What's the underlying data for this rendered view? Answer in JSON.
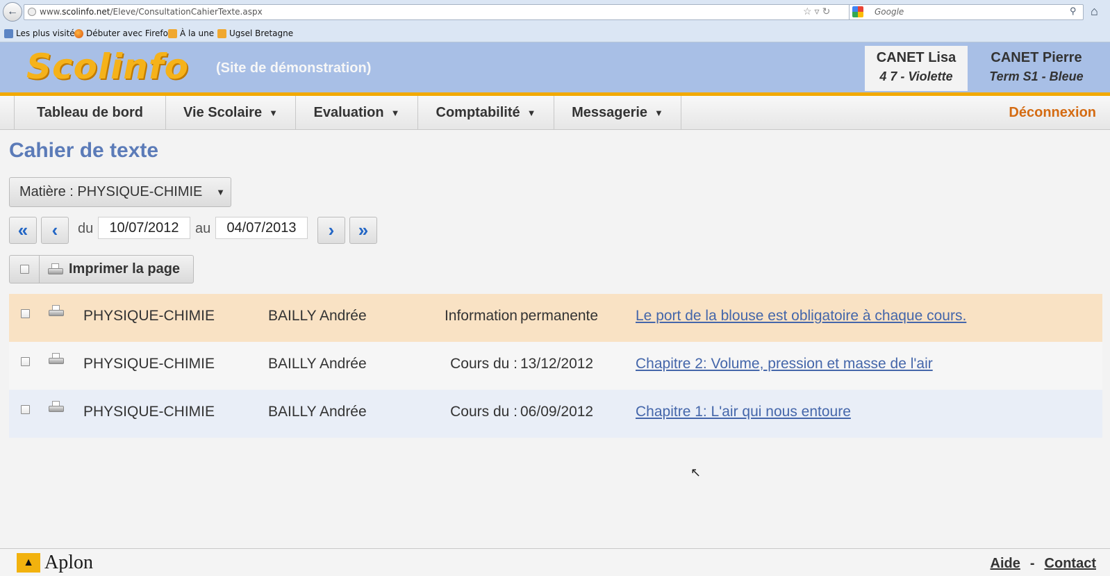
{
  "browser": {
    "url_prefix": "www.",
    "url_domain": "scolinfo.net",
    "url_path": "/Eleve/ConsultationCahierTexte.aspx",
    "search_placeholder": "Google",
    "bookmarks": [
      "Les plus visités",
      "Débuter avec Firefox",
      "À la une",
      "Ugsel Bretagne"
    ]
  },
  "header": {
    "logo": "Scolinfo",
    "demo_note": "(Site de démonstration)",
    "users": [
      {
        "name": "CANET Lisa",
        "class": "4 7 - Violette"
      },
      {
        "name": "CANET Pierre",
        "class": "Term S1 - Bleue"
      }
    ]
  },
  "nav": {
    "items": [
      {
        "label": "Tableau de bord"
      },
      {
        "label": "Vie Scolaire"
      },
      {
        "label": "Evaluation"
      },
      {
        "label": "Comptabilité"
      },
      {
        "label": "Messagerie"
      }
    ],
    "caret": "▼",
    "logout": "Déconnexion"
  },
  "page": {
    "title": "Cahier de texte",
    "subject_select": "Matière : PHYSIQUE-CHIMIE",
    "from_label": "du",
    "from_date": "10/07/2012",
    "to_label": "au",
    "to_date": "04/07/2013",
    "print_label": "Imprimer la page"
  },
  "entries": [
    {
      "subject": "PHYSIQUE-CHIMIE",
      "teacher": "BAILLY Andrée",
      "label": "Information",
      "date": "permanente",
      "link": "Le port de la blouse est obligatoire à chaque cours."
    },
    {
      "subject": "PHYSIQUE-CHIMIE",
      "teacher": "BAILLY Andrée",
      "label": "Cours du :",
      "date": "13/12/2012",
      "link": "Chapitre 2: Volume, pression et masse de l'air"
    },
    {
      "subject": "PHYSIQUE-CHIMIE",
      "teacher": "BAILLY Andrée",
      "label": "Cours du :",
      "date": "06/09/2012",
      "link": "Chapitre 1: L'air qui nous entoure"
    }
  ],
  "footer": {
    "brand": "Aplon",
    "help": "Aide",
    "separator": "-",
    "contact": "Contact"
  },
  "colors": {
    "header_bg": "#a8bfe6",
    "accent_orange": "#f2a900",
    "title_blue": "#5b7bb8",
    "logout_orange": "#d46b12",
    "highlight_row": "#f9e2c4"
  }
}
